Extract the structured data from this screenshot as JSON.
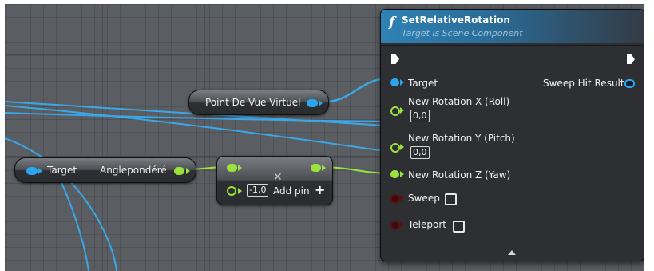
{
  "colors": {
    "grid_background": "#5a5d62",
    "object_pin": "#2aa5ee",
    "float_pin": "#9ae33d",
    "bool_pin": "#5b1010",
    "header_accent": "#2f82b5"
  },
  "icons": {
    "function": "f",
    "add_pin": "+",
    "remove_pin": "✕"
  },
  "nodes": {
    "point_de_vue": {
      "label": "Point De Vue Virtuel"
    },
    "target_get": {
      "target_label": "Target",
      "output_label": "Anglepondéré"
    },
    "add_node": {
      "input_value": "-1,0",
      "add_pin_label": "Add pin",
      "add_icon": "+"
    },
    "set_relative_rotation": {
      "title": "SetRelativeRotation",
      "subtitle": "Target is Scene Component",
      "pins": {
        "target": "Target",
        "sweep_hit_result": "Sweep Hit Result",
        "rot_x": {
          "label": "New Rotation X (Roll)",
          "value": "0,0"
        },
        "rot_y": {
          "label": "New Rotation Y (Pitch)",
          "value": "0,0"
        },
        "rot_z": "New Rotation Z (Yaw)",
        "sweep": "Sweep",
        "teleport": "Teleport"
      }
    }
  }
}
